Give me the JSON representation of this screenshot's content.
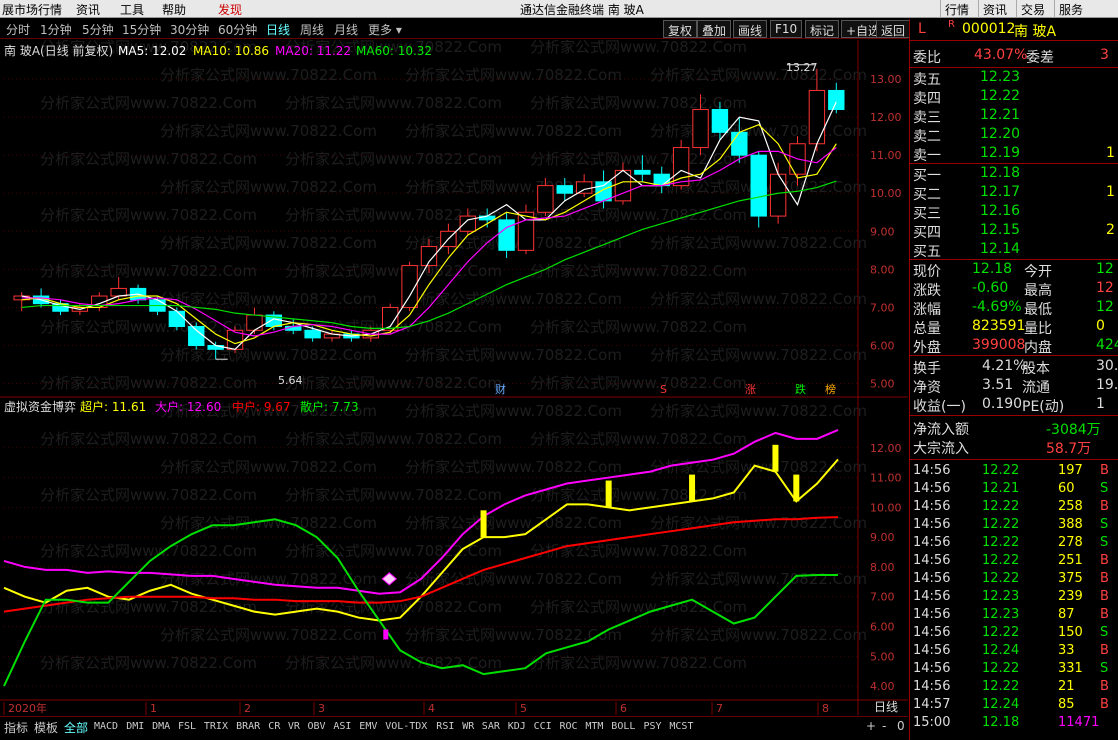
{
  "menubar": {
    "items": [
      "展市场行情",
      "资讯",
      "工具",
      "帮助",
      "发现"
    ],
    "title": "通达信金融终端 南 玻A",
    "right": [
      "行情",
      "资讯",
      "交易",
      "服务"
    ]
  },
  "periods": [
    "分时",
    "1分钟",
    "5分钟",
    "15分钟",
    "30分钟",
    "60分钟",
    "日线",
    "周线",
    "月线",
    "更多"
  ],
  "selected_period": "日线",
  "tools": [
    "复权",
    "叠加",
    "画线",
    "F10",
    "标记",
    "+自选",
    "返回"
  ],
  "main_legend": {
    "name": "南 玻A(日线 前复权)",
    "ma5": "MA5: 12.02",
    "ma10": "MA10: 10.86",
    "ma20": "MA20: 11.22",
    "ma60": "MA60: 10.32"
  },
  "sub_legend": {
    "name": "虚拟资金博弈",
    "super": "超户: 11.61",
    "big": "大户: 12.60",
    "mid": "中户: 9.67",
    "retail": "散户: 7.73"
  },
  "watermark": "分析家公式网www.70822.Com",
  "events": [
    "财",
    "S",
    "涨",
    "跌",
    "榜"
  ],
  "annotations": {
    "high": "13.27",
    "low": "5.64"
  },
  "x_labels": [
    "2020年",
    "1",
    "2",
    "3",
    "4",
    "5",
    "6",
    "7",
    "8"
  ],
  "axis_mode": "日线",
  "bottom_tabs": [
    "指标",
    "模板",
    "全部",
    "MACD",
    "DMI",
    "DMA",
    "FSL",
    "TRIX",
    "BRAR",
    "CR",
    "VR",
    "OBV",
    "ASI",
    "EMV",
    "VOL-TDX",
    "RSI",
    "WR",
    "SAR",
    "KDJ",
    "CCI",
    "ROC",
    "MTM",
    "BOLL",
    "PSY",
    "MCST"
  ],
  "bottom_right": [
    "+",
    "-",
    "0"
  ],
  "chart_data": [
    {
      "type": "candlestick",
      "y_ticks": [
        "13.00",
        "12.00",
        "11.00",
        "10.00",
        "9.00",
        "8.00",
        "7.00",
        "6.00",
        "5.00"
      ],
      "ylim": [
        4.7,
        13.5
      ],
      "x_months": [
        "1",
        "2",
        "3",
        "4",
        "5",
        "6",
        "7",
        "8"
      ],
      "series": [
        {
          "name": "MA5",
          "values": [
            7.3,
            7.2,
            7.05,
            6.95,
            7.1,
            7.3,
            7.35,
            7.2,
            6.9,
            6.4,
            6.0,
            5.9,
            6.4,
            6.7,
            6.6,
            6.45,
            6.3,
            6.25,
            6.3,
            6.5,
            7.3,
            8.2,
            8.8,
            9.3,
            9.4,
            9.7,
            9.3,
            9.3,
            9.8,
            10.1,
            10.2,
            10.6,
            10.2,
            10.2,
            10.6,
            10.4,
            11.4,
            12.0,
            11.9,
            10.5,
            9.7,
            11.3,
            12.4
          ]
        },
        {
          "name": "MA10",
          "values": [
            7.2,
            7.25,
            7.1,
            7.0,
            7.0,
            7.2,
            7.3,
            7.3,
            7.1,
            6.7,
            6.3,
            6.05,
            6.2,
            6.5,
            6.6,
            6.55,
            6.4,
            6.3,
            6.25,
            6.35,
            6.8,
            7.6,
            8.3,
            8.9,
            9.2,
            9.5,
            9.4,
            9.3,
            9.5,
            9.8,
            10.1,
            10.3,
            10.3,
            10.2,
            10.4,
            10.5,
            10.9,
            11.6,
            11.8,
            11.3,
            10.4,
            10.5,
            11.3
          ]
        },
        {
          "name": "MA20",
          "values": [
            7.25,
            7.25,
            7.2,
            7.1,
            7.05,
            7.1,
            7.2,
            7.25,
            7.2,
            6.95,
            6.65,
            6.35,
            6.25,
            6.35,
            6.5,
            6.55,
            6.5,
            6.4,
            6.3,
            6.3,
            6.5,
            7.0,
            7.6,
            8.2,
            8.7,
            9.1,
            9.3,
            9.35,
            9.4,
            9.6,
            9.8,
            10.0,
            10.2,
            10.2,
            10.3,
            10.35,
            10.6,
            10.9,
            11.1,
            11.1,
            10.9,
            10.8,
            11.2
          ]
        },
        {
          "name": "MA60",
          "values": [
            7.0,
            7.05,
            7.05,
            7.05,
            7.05,
            7.05,
            7.05,
            7.05,
            7.05,
            7.0,
            6.95,
            6.85,
            6.8,
            6.75,
            6.7,
            6.65,
            6.6,
            6.5,
            6.45,
            6.45,
            6.5,
            6.65,
            6.85,
            7.1,
            7.35,
            7.6,
            7.8,
            8.0,
            8.25,
            8.45,
            8.65,
            8.85,
            9.05,
            9.2,
            9.35,
            9.5,
            9.65,
            9.8,
            9.9,
            10.0,
            10.05,
            10.15,
            10.32
          ]
        }
      ],
      "candles": [
        [
          7.2,
          7.4,
          6.9,
          7.3
        ],
        [
          7.3,
          7.5,
          7.0,
          7.1
        ],
        [
          7.1,
          7.2,
          6.8,
          6.9
        ],
        [
          6.9,
          7.1,
          6.8,
          7.0
        ],
        [
          7.0,
          7.4,
          6.9,
          7.3
        ],
        [
          7.3,
          7.8,
          7.2,
          7.5
        ],
        [
          7.5,
          7.6,
          7.1,
          7.2
        ],
        [
          7.2,
          7.3,
          6.8,
          6.9
        ],
        [
          6.9,
          7.0,
          6.4,
          6.5
        ],
        [
          6.5,
          6.6,
          5.9,
          6.0
        ],
        [
          6.0,
          6.1,
          5.64,
          5.9
        ],
        [
          5.9,
          6.5,
          5.8,
          6.4
        ],
        [
          6.4,
          7.0,
          6.3,
          6.8
        ],
        [
          6.8,
          6.9,
          6.4,
          6.5
        ],
        [
          6.5,
          6.7,
          6.3,
          6.4
        ],
        [
          6.4,
          6.5,
          6.1,
          6.2
        ],
        [
          6.2,
          6.4,
          6.1,
          6.3
        ],
        [
          6.3,
          6.4,
          6.1,
          6.2
        ],
        [
          6.2,
          6.5,
          6.1,
          6.4
        ],
        [
          6.4,
          7.1,
          6.3,
          7.0
        ],
        [
          7.0,
          8.2,
          6.9,
          8.1
        ],
        [
          8.1,
          8.8,
          7.9,
          8.6
        ],
        [
          8.6,
          9.2,
          8.4,
          9.0
        ],
        [
          9.0,
          9.6,
          8.9,
          9.4
        ],
        [
          9.4,
          9.6,
          9.1,
          9.3
        ],
        [
          9.3,
          9.5,
          8.3,
          8.5
        ],
        [
          8.5,
          9.7,
          8.4,
          9.5
        ],
        [
          9.5,
          10.4,
          9.4,
          10.2
        ],
        [
          10.2,
          10.4,
          9.8,
          10.0
        ],
        [
          10.0,
          10.5,
          9.9,
          10.3
        ],
        [
          10.3,
          10.6,
          9.6,
          9.8
        ],
        [
          9.8,
          10.8,
          9.7,
          10.6
        ],
        [
          10.6,
          11.0,
          10.3,
          10.5
        ],
        [
          10.5,
          10.7,
          10.0,
          10.2
        ],
        [
          10.2,
          11.4,
          10.1,
          11.2
        ],
        [
          11.2,
          12.6,
          11.0,
          12.2
        ],
        [
          12.2,
          12.4,
          11.4,
          11.6
        ],
        [
          11.6,
          12.0,
          10.8,
          11.0
        ],
        [
          11.0,
          11.1,
          9.1,
          9.4
        ],
        [
          9.4,
          10.8,
          9.2,
          10.5
        ],
        [
          10.5,
          11.5,
          10.2,
          11.3
        ],
        [
          11.3,
          13.27,
          11.1,
          12.7
        ],
        [
          12.7,
          12.9,
          12.1,
          12.2
        ]
      ]
    },
    {
      "type": "line",
      "y_ticks": [
        "12.00",
        "11.00",
        "10.00",
        "9.00",
        "8.00",
        "7.00",
        "6.00",
        "5.00",
        "4.00"
      ],
      "ylim": [
        3.7,
        13.0
      ],
      "series": [
        {
          "name": "超户",
          "values": [
            7.3,
            7.0,
            6.8,
            7.2,
            7.3,
            7.0,
            6.9,
            7.2,
            7.4,
            7.1,
            6.9,
            6.7,
            6.5,
            6.4,
            6.5,
            6.6,
            6.5,
            6.3,
            6.2,
            6.3,
            7.0,
            7.8,
            8.6,
            9.0,
            9.0,
            9.1,
            9.6,
            10.1,
            10.1,
            10.0,
            9.9,
            10.0,
            10.1,
            10.2,
            10.3,
            10.5,
            11.4,
            11.2,
            10.2,
            10.8,
            11.61
          ]
        },
        {
          "name": "大户",
          "values": [
            8.2,
            8.0,
            7.9,
            7.9,
            7.8,
            7.85,
            7.8,
            7.8,
            7.75,
            7.7,
            7.7,
            7.6,
            7.5,
            7.4,
            7.35,
            7.3,
            7.3,
            7.2,
            7.1,
            7.15,
            7.6,
            8.3,
            9.1,
            9.7,
            10.1,
            10.4,
            10.6,
            10.8,
            10.9,
            11.0,
            11.1,
            11.2,
            11.4,
            11.5,
            11.6,
            11.8,
            12.2,
            12.5,
            12.3,
            12.3,
            12.6
          ]
        },
        {
          "name": "中户",
          "values": [
            6.5,
            6.6,
            6.7,
            6.8,
            6.9,
            6.95,
            7.0,
            7.0,
            7.0,
            7.0,
            6.95,
            6.95,
            6.9,
            6.9,
            6.85,
            6.85,
            6.85,
            6.8,
            6.8,
            6.85,
            7.0,
            7.3,
            7.6,
            7.9,
            8.1,
            8.3,
            8.5,
            8.7,
            8.8,
            8.9,
            9.0,
            9.1,
            9.2,
            9.3,
            9.4,
            9.5,
            9.55,
            9.6,
            9.6,
            9.65,
            9.67
          ]
        },
        {
          "name": "散户",
          "values": [
            4.0,
            5.5,
            6.9,
            6.9,
            6.8,
            6.8,
            7.5,
            8.2,
            8.7,
            9.1,
            9.4,
            9.4,
            9.5,
            9.6,
            9.4,
            9.0,
            8.3,
            7.2,
            6.2,
            5.2,
            4.8,
            4.6,
            4.7,
            4.4,
            4.5,
            4.6,
            5.1,
            5.3,
            5.5,
            5.9,
            6.2,
            6.5,
            6.7,
            6.9,
            6.5,
            6.1,
            6.3,
            7.0,
            7.7,
            7.73,
            7.73
          ]
        }
      ]
    }
  ],
  "right_panel": {
    "code_prefix": "L",
    "code": "000012",
    "name": "南 玻A",
    "weibi": {
      "label": "委比",
      "value": "43.07%",
      "label2": "委差",
      "value2": "3"
    },
    "asks": [
      {
        "label": "卖五",
        "price": "12.23",
        "vol": ""
      },
      {
        "label": "卖四",
        "price": "12.22",
        "vol": ""
      },
      {
        "label": "卖三",
        "price": "12.21",
        "vol": ""
      },
      {
        "label": "卖二",
        "price": "12.20",
        "vol": ""
      },
      {
        "label": "卖一",
        "price": "12.19",
        "vol": "1"
      }
    ],
    "bids": [
      {
        "label": "买一",
        "price": "12.18",
        "vol": ""
      },
      {
        "label": "买二",
        "price": "12.17",
        "vol": "1"
      },
      {
        "label": "买三",
        "price": "12.16",
        "vol": ""
      },
      {
        "label": "买四",
        "price": "12.15",
        "vol": "2"
      },
      {
        "label": "买五",
        "price": "12.14",
        "vol": ""
      }
    ],
    "quote": [
      {
        "l1": "现价",
        "v1": "12.18",
        "c1": "green",
        "l2": "今开",
        "v2": "12",
        "c2": "green"
      },
      {
        "l1": "涨跌",
        "v1": "-0.60",
        "c1": "green",
        "l2": "最高",
        "v2": "12",
        "c2": "red"
      },
      {
        "l1": "涨幅",
        "v1": "-4.69%",
        "c1": "green",
        "l2": "最低",
        "v2": "12",
        "c2": "green"
      },
      {
        "l1": "总量",
        "v1": "823591",
        "c1": "yellow",
        "l2": "量比",
        "v2": "0",
        "c2": "yellow"
      },
      {
        "l1": "外盘",
        "v1": "399008",
        "c1": "red",
        "l2": "内盘",
        "v2": "424",
        "c2": "green"
      }
    ],
    "stats": [
      {
        "l1": "换手",
        "v1": "4.21%",
        "l2": "股本",
        "v2": "30."
      },
      {
        "l1": "净资",
        "v1": "3.51",
        "l2": "流通",
        "v2": "19."
      },
      {
        "l1": "收益(一)",
        "v1": "0.190",
        "l2": "PE(动)",
        "v2": "1"
      }
    ],
    "flow": [
      {
        "label": "净流入额",
        "value": "-3084万",
        "color": "green"
      },
      {
        "label": "大宗流入",
        "value": "58.7万",
        "color": "red"
      }
    ],
    "ticks": [
      [
        "14:56",
        "12.22",
        "197",
        "B"
      ],
      [
        "14:56",
        "12.21",
        "60",
        "S"
      ],
      [
        "14:56",
        "12.22",
        "258",
        "B"
      ],
      [
        "14:56",
        "12.22",
        "388",
        "S"
      ],
      [
        "14:56",
        "12.22",
        "278",
        "S"
      ],
      [
        "14:56",
        "12.22",
        "251",
        "B"
      ],
      [
        "14:56",
        "12.22",
        "375",
        "B"
      ],
      [
        "14:56",
        "12.23",
        "239",
        "B"
      ],
      [
        "14:56",
        "12.23",
        "87",
        "B"
      ],
      [
        "14:56",
        "12.22",
        "150",
        "S"
      ],
      [
        "14:56",
        "12.24",
        "33",
        "B"
      ],
      [
        "14:56",
        "12.22",
        "331",
        "S"
      ],
      [
        "14:56",
        "12.22",
        "21",
        "B"
      ],
      [
        "14:57",
        "12.24",
        "85",
        "B"
      ],
      [
        "15:00",
        "12.18",
        "11471",
        ""
      ]
    ]
  },
  "colors": {
    "up": "#ff3232",
    "down": "#00ffff",
    "ma5": "#ffffff",
    "ma10": "#ffff00",
    "ma20": "#ff00ff",
    "ma60": "#00e000",
    "super": "#ffff00",
    "big": "#ff00ff",
    "mid": "#ff0000",
    "retail": "#00e000",
    "grid": "#800000"
  }
}
